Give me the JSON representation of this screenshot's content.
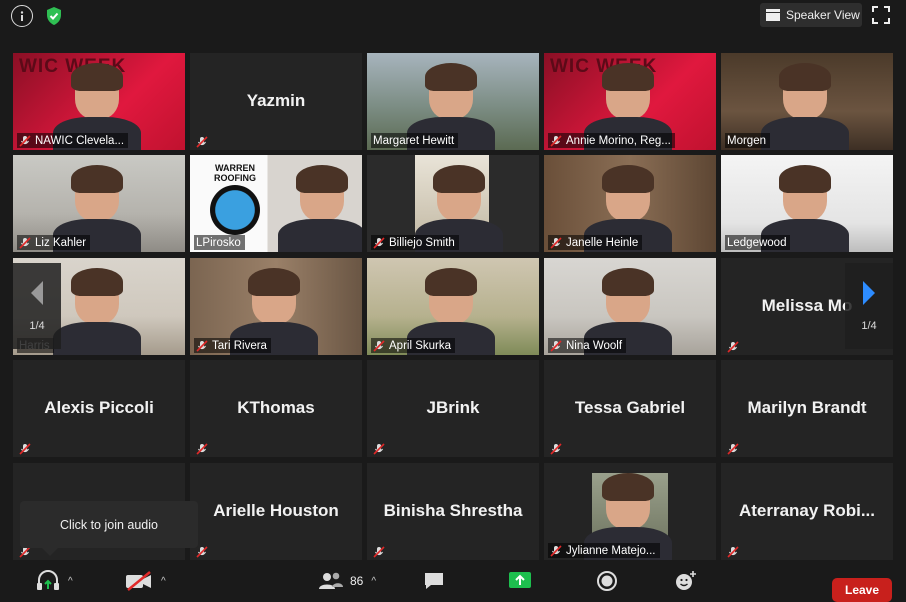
{
  "topbar": {
    "info_icon": "info-icon",
    "security_icon": "shield-check-icon",
    "speaker_view_label": "Speaker View",
    "fullscreen_icon": "fullscreen-icon"
  },
  "tiles": [
    {
      "name": "NAWIC Clevela...",
      "banner": "WIC WEEK",
      "video": true
    },
    {
      "name": "Yazmin",
      "video": false
    },
    {
      "name": "Margaret Hewitt",
      "video": true
    },
    {
      "name": "Annie Morino, Reg...",
      "banner": "WIC WEEK",
      "video": true
    },
    {
      "name": "Morgen",
      "video": true,
      "active": true
    },
    {
      "name": "Liz Kahler",
      "video": true
    },
    {
      "name": "LPirosko",
      "logo": "WARREN ROOFING",
      "video": true
    },
    {
      "name": "Billiejo Smith",
      "video": true
    },
    {
      "name": "Janelle Heinle",
      "video": true
    },
    {
      "name": "Ledgewood",
      "video": true
    },
    {
      "name": "Harris",
      "video": true
    },
    {
      "name": "Tari Rivera",
      "video": true
    },
    {
      "name": "April Skurka",
      "video": true
    },
    {
      "name": "Nina Woolf",
      "video": true
    },
    {
      "name": "Melissa Mo",
      "video": false
    },
    {
      "name": "Alexis Piccoli",
      "video": false
    },
    {
      "name": "KThomas",
      "video": false
    },
    {
      "name": "JBrink",
      "video": false
    },
    {
      "name": "Tessa Gabriel",
      "video": false
    },
    {
      "name": "Marilyn Brandt",
      "video": false
    },
    {
      "name": "",
      "video": false
    },
    {
      "name": "Arielle Houston",
      "video": false
    },
    {
      "name": "Binisha Shrestha",
      "video": false
    },
    {
      "name": "Jylianne Matejo...",
      "video": true
    },
    {
      "name": "Aterranay  Robi...",
      "video": false
    }
  ],
  "nav": {
    "prev_page": "1/4",
    "next_page": "1/4"
  },
  "tooltip": {
    "text": "Click to join audio"
  },
  "toolbar": {
    "audio_icon": "headphones-join-audio-icon",
    "video_icon": "video-off-icon",
    "participants_icon": "participants-icon",
    "participants_count": "86",
    "chat_icon": "chat-icon",
    "share_icon": "share-screen-icon",
    "record_icon": "record-icon",
    "reactions_icon": "reactions-icon",
    "leave_label": "Leave"
  },
  "colors": {
    "active_speaker_border": "#c8e06a",
    "leave": "#c8201c",
    "share_green": "#1dbf4e",
    "muted_red": "#e02828"
  }
}
